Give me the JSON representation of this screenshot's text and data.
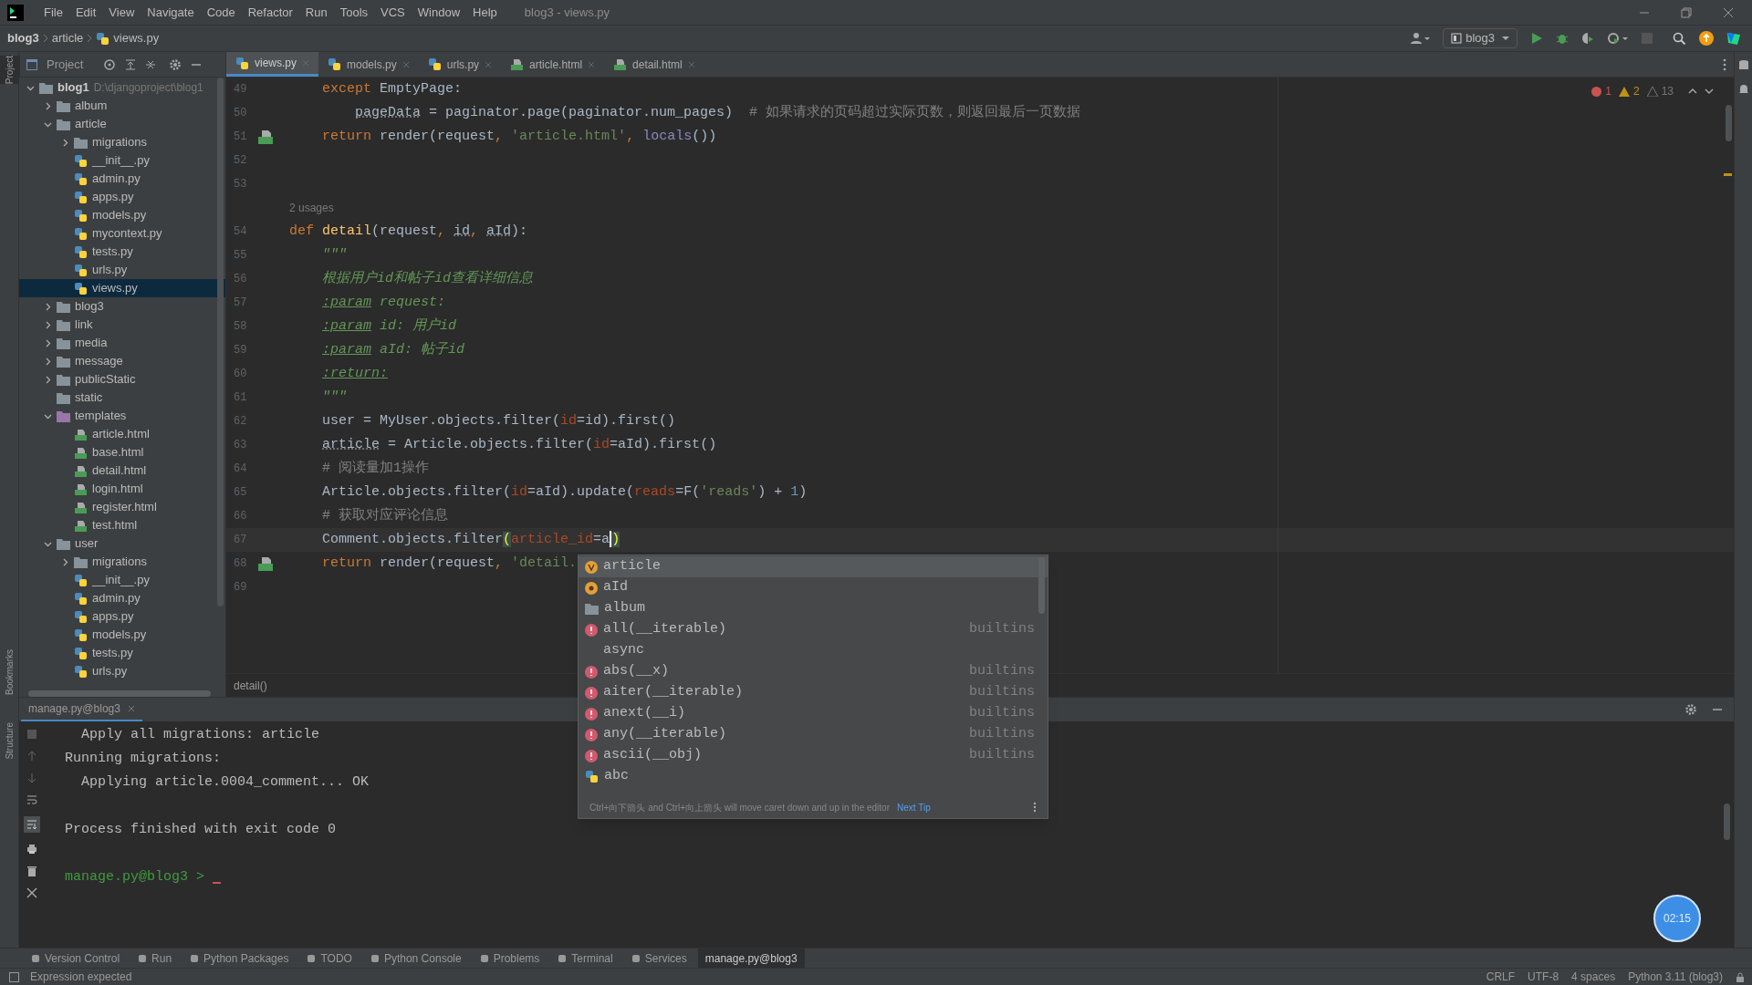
{
  "menu": [
    "File",
    "Edit",
    "View",
    "Navigate",
    "Code",
    "Refactor",
    "Run",
    "Tools",
    "VCS",
    "Window",
    "Help"
  ],
  "window": {
    "title": "blog3 - views.py"
  },
  "breadcrumbs": [
    "blog3",
    "article",
    "views.py"
  ],
  "run_config": "blog3",
  "project_panel": {
    "title": "Project"
  },
  "tabs": [
    {
      "label": "views.py",
      "kind": "py",
      "selected": true
    },
    {
      "label": "models.py",
      "kind": "py",
      "selected": false
    },
    {
      "label": "urls.py",
      "kind": "py",
      "selected": false
    },
    {
      "label": "article.html",
      "kind": "html",
      "selected": false
    },
    {
      "label": "detail.html",
      "kind": "html",
      "selected": false
    }
  ],
  "tree": [
    {
      "label": "blog1",
      "path": "D:\\djangoproject\\blog1",
      "kind": "folder",
      "expanded": true,
      "selected": false,
      "children": [
        {
          "label": "album",
          "kind": "folder",
          "expanded": false,
          "selected": false
        },
        {
          "label": "article",
          "kind": "folder",
          "expanded": true,
          "selected": false,
          "children": [
            {
              "label": "migrations",
              "kind": "folder",
              "expanded": false,
              "selected": false
            },
            {
              "label": "__init__.py",
              "kind": "py",
              "selected": false
            },
            {
              "label": "admin.py",
              "kind": "py",
              "selected": false
            },
            {
              "label": "apps.py",
              "kind": "py",
              "selected": false
            },
            {
              "label": "models.py",
              "kind": "py",
              "selected": false
            },
            {
              "label": "mycontext.py",
              "kind": "py",
              "selected": false
            },
            {
              "label": "tests.py",
              "kind": "py",
              "selected": false
            },
            {
              "label": "urls.py",
              "kind": "py",
              "selected": false
            },
            {
              "label": "views.py",
              "kind": "py",
              "selected": true
            }
          ]
        },
        {
          "label": "blog3",
          "kind": "folder",
          "expanded": false,
          "selected": false
        },
        {
          "label": "link",
          "kind": "folder",
          "expanded": false,
          "selected": false
        },
        {
          "label": "media",
          "kind": "folder",
          "expanded": false,
          "selected": false
        },
        {
          "label": "message",
          "kind": "folder",
          "expanded": false,
          "selected": false
        },
        {
          "label": "publicStatic",
          "kind": "folder",
          "expanded": false,
          "selected": false
        },
        {
          "label": "static",
          "kind": "folder",
          "selected": false
        },
        {
          "label": "templates",
          "kind": "templates",
          "expanded": true,
          "selected": false,
          "children": [
            {
              "label": "article.html",
              "kind": "html",
              "selected": false
            },
            {
              "label": "base.html",
              "kind": "html",
              "selected": false
            },
            {
              "label": "detail.html",
              "kind": "html",
              "selected": false
            },
            {
              "label": "login.html",
              "kind": "html",
              "selected": false
            },
            {
              "label": "register.html",
              "kind": "html",
              "selected": false
            },
            {
              "label": "test.html",
              "kind": "html",
              "selected": false
            }
          ]
        },
        {
          "label": "user",
          "kind": "folder",
          "expanded": true,
          "selected": false,
          "children": [
            {
              "label": "migrations",
              "kind": "folder",
              "expanded": false,
              "selected": false
            },
            {
              "label": "__init__.py",
              "kind": "py",
              "selected": false
            },
            {
              "label": "admin.py",
              "kind": "py",
              "selected": false
            },
            {
              "label": "apps.py",
              "kind": "py",
              "selected": false
            },
            {
              "label": "models.py",
              "kind": "py",
              "selected": false
            },
            {
              "label": "tests.py",
              "kind": "py",
              "selected": false
            },
            {
              "label": "urls.py",
              "kind": "py",
              "selected": false
            }
          ]
        }
      ]
    }
  ],
  "inspections": {
    "errors": "1",
    "warnings": "2",
    "weak": "13"
  },
  "code": [
    {
      "n": "49",
      "tokens": [
        {
          "text": "    except",
          "kind": "keyword"
        },
        {
          "text": " EmptyPage:"
        }
      ]
    },
    {
      "n": "50",
      "tokens": [
        {
          "text": "        pageData",
          "kind": "weak"
        },
        {
          "text": " = paginator.page(paginator.num_pages)  "
        },
        {
          "text": "# 如果请求的页码超过实际页数，则返回最后一页数据",
          "kind": "comment"
        }
      ]
    },
    {
      "n": "51",
      "gutter": {
        "kind": "html"
      },
      "tokens": [
        {
          "text": "    return",
          "kind": "keyword"
        },
        {
          "text": " render(request"
        },
        {
          "text": ", ",
          "kind": "keyword"
        },
        {
          "text": "'article.html'",
          "kind": "string"
        },
        {
          "text": ", ",
          "kind": "keyword"
        },
        {
          "text": "locals",
          "kind": "builtin"
        },
        {
          "text": "())"
        }
      ]
    },
    {
      "n": "52"
    },
    {
      "n": "53"
    },
    {
      "kind": "inlay",
      "text": "2 usages"
    },
    {
      "n": "54",
      "tokens": [
        {
          "text": "def ",
          "kind": "keyword"
        },
        {
          "text": "detail",
          "kind": "function"
        },
        {
          "text": "(request"
        },
        {
          "text": ", ",
          "kind": "keyword"
        },
        {
          "text": "id",
          "kind": "weak"
        },
        {
          "text": ", ",
          "kind": "keyword"
        },
        {
          "text": "aId",
          "kind": "weak"
        },
        {
          "text": "):"
        }
      ]
    },
    {
      "n": "55",
      "tokens": [
        {
          "text": "    \"\"\"",
          "kind": "doc"
        }
      ]
    },
    {
      "n": "56",
      "tokens": [
        {
          "text": "    根据用户id和帖子id查看详细信息",
          "kind": "doc"
        }
      ]
    },
    {
      "n": "57",
      "tokens": [
        {
          "text": "    :param",
          "kind": "doctag"
        },
        {
          "text": " request:",
          "kind": "doc"
        }
      ]
    },
    {
      "n": "58",
      "tokens": [
        {
          "text": "    :param",
          "kind": "doctag"
        },
        {
          "text": " id: 用户id",
          "kind": "doc"
        }
      ]
    },
    {
      "n": "59",
      "tokens": [
        {
          "text": "    :param",
          "kind": "doctag"
        },
        {
          "text": " aId: 帖子id",
          "kind": "doc"
        }
      ]
    },
    {
      "n": "60",
      "tokens": [
        {
          "text": "    :return:",
          "kind": "doctag"
        }
      ]
    },
    {
      "n": "61",
      "tokens": [
        {
          "text": "    \"\"\"",
          "kind": "doc"
        }
      ]
    },
    {
      "n": "62",
      "tokens": [
        {
          "text": "    user = MyUser.objects.filter("
        },
        {
          "text": "id",
          "kind": "named"
        },
        {
          "text": "=id).first()"
        }
      ]
    },
    {
      "n": "63",
      "tokens": [
        {
          "text": "    article",
          "kind": "weak"
        },
        {
          "text": " = Article.objects.filter("
        },
        {
          "text": "id",
          "kind": "named"
        },
        {
          "text": "=aId).first()"
        }
      ]
    },
    {
      "n": "64",
      "tokens": [
        {
          "text": "    # 阅读量加1操作",
          "kind": "comment"
        }
      ]
    },
    {
      "n": "65",
      "tokens": [
        {
          "text": "    Article.objects.filter("
        },
        {
          "text": "id",
          "kind": "named"
        },
        {
          "text": "=aId).update("
        },
        {
          "text": "reads",
          "kind": "named"
        },
        {
          "text": "=F("
        },
        {
          "text": "'reads'",
          "kind": "string"
        },
        {
          "text": ") + "
        },
        {
          "text": "1",
          "kind": "number"
        },
        {
          "text": ")"
        }
      ]
    },
    {
      "n": "66",
      "tokens": [
        {
          "text": "    # 获取对应评论信息",
          "kind": "comment"
        }
      ]
    },
    {
      "n": "67",
      "current": true,
      "tokens": [
        {
          "text": "    Comment.objects.filter"
        },
        {
          "text": "(",
          "kind": "match"
        },
        {
          "text": "article_id",
          "kind": "named"
        },
        {
          "text": "="
        },
        {
          "text": "a",
          "caret": true
        },
        {
          "text": ")",
          "kind": "match"
        }
      ]
    },
    {
      "n": "68",
      "gutter": {
        "kind": "html"
      },
      "tokens": [
        {
          "text": "    return",
          "kind": "keyword"
        },
        {
          "text": " render(request"
        },
        {
          "text": ", ",
          "kind": "keyword"
        },
        {
          "text": "'detail.",
          "kind": "string"
        }
      ]
    },
    {
      "n": "69"
    }
  ],
  "editor_breadcrumb": "detail()",
  "completion": {
    "items": [
      {
        "label": "article",
        "kind": "variable",
        "selected": true
      },
      {
        "label": "aId",
        "kind": "parameter",
        "selected": false
      },
      {
        "label": "album",
        "kind": "folder",
        "selected": false
      },
      {
        "label": "all(__iterable)",
        "kind": "function",
        "type": "builtins",
        "selected": false
      },
      {
        "label": "async",
        "kind": "keyword",
        "selected": false
      },
      {
        "label": "abs(__x)",
        "kind": "function",
        "type": "builtins",
        "selected": false
      },
      {
        "label": "aiter(__iterable)",
        "kind": "function",
        "type": "builtins",
        "selected": false
      },
      {
        "label": "anext(__i)",
        "kind": "function",
        "type": "builtins",
        "selected": false
      },
      {
        "label": "any(__iterable)",
        "kind": "function",
        "type": "builtins",
        "selected": false
      },
      {
        "label": "ascii(__obj)",
        "kind": "function",
        "type": "builtins",
        "selected": false
      },
      {
        "label": "abc",
        "kind": "package",
        "selected": false
      }
    ],
    "hint": "Ctrl+向下箭头 and Ctrl+向上箭头 will move caret down and up in the editor",
    "hint_link": "Next Tip"
  },
  "run_panel": {
    "tab": "manage.py@blog3",
    "lines": [
      {
        "text": "  Apply all migrations: article",
        "kind": "out"
      },
      {
        "text": "Running migrations:",
        "kind": "out"
      },
      {
        "text": "  Applying article.0004_comment... OK",
        "kind": "out"
      },
      {
        "kind": "blank"
      },
      {
        "text": "Process finished with exit code 0",
        "kind": "out"
      },
      {
        "kind": "blank"
      },
      {
        "text": "manage.py@blog3 > ",
        "kind": "prompt"
      }
    ]
  },
  "timer": "02:15",
  "left_stripe": [
    "Project",
    "Bookmarks",
    "Structure"
  ],
  "tool_windows": [
    {
      "label": "Version Control",
      "selected": false
    },
    {
      "label": "Run",
      "selected": false
    },
    {
      "label": "Python Packages",
      "selected": false
    },
    {
      "label": "TODO",
      "selected": false
    },
    {
      "label": "Python Console",
      "selected": false
    },
    {
      "label": "Problems",
      "selected": false
    },
    {
      "label": "Terminal",
      "selected": false
    },
    {
      "label": "Services",
      "selected": false
    },
    {
      "label": "manage.py@blog3",
      "selected": true
    }
  ],
  "status_bar": {
    "message": "Expression expected",
    "items": [
      "CRLF",
      "UTF-8",
      "4 spaces",
      "Python 3.11 (blog3)"
    ]
  }
}
